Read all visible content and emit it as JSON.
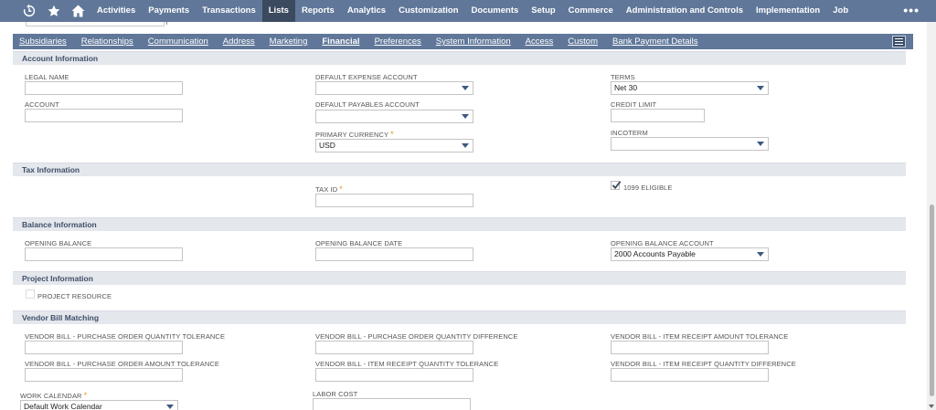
{
  "topnav": {
    "items": [
      "Activities",
      "Payments",
      "Transactions",
      "Lists",
      "Reports",
      "Analytics",
      "Customization",
      "Documents",
      "Setup",
      "Commerce",
      "Administration and Controls",
      "Implementation",
      "Job"
    ],
    "more": "•••"
  },
  "subtabs": [
    "Subsidiaries",
    "Relationships",
    "Communication",
    "Address",
    "Marketing",
    "Financial",
    "Preferences",
    "System Information",
    "Access",
    "Custom",
    "Bank Payment Details"
  ],
  "sections": {
    "account": "Account Information",
    "tax": "Tax Information",
    "balance": "Balance Information",
    "project": "Project Information",
    "vbm": "Vendor Bill Matching"
  },
  "fields": {
    "legal_name": {
      "label": "LEGAL NAME",
      "value": ""
    },
    "account": {
      "label": "ACCOUNT",
      "value": ""
    },
    "default_expense_account": {
      "label": "DEFAULT EXPENSE ACCOUNT",
      "value": ""
    },
    "default_payables_account": {
      "label": "DEFAULT PAYABLES ACCOUNT",
      "value": ""
    },
    "primary_currency": {
      "label": "PRIMARY CURRENCY",
      "value": "USD"
    },
    "terms": {
      "label": "TERMS",
      "value": "Net 30"
    },
    "credit_limit": {
      "label": "CREDIT LIMIT",
      "value": ""
    },
    "incoterm": {
      "label": "INCOTERM",
      "value": ""
    },
    "tax_id": {
      "label": "TAX ID",
      "value": ""
    },
    "eligible_1099": {
      "label": "1099 ELIGIBLE",
      "checked": true
    },
    "opening_balance": {
      "label": "OPENING BALANCE",
      "value": ""
    },
    "opening_balance_date": {
      "label": "OPENING BALANCE DATE",
      "value": ""
    },
    "opening_balance_account": {
      "label": "OPENING BALANCE ACCOUNT",
      "value": "2000 Accounts Payable"
    },
    "project_resource": {
      "label": "PROJECT RESOURCE",
      "checked": false
    },
    "vb_po_qty_tol": {
      "label": "VENDOR BILL - PURCHASE ORDER QUANTITY TOLERANCE",
      "value": ""
    },
    "vb_po_qty_diff": {
      "label": "VENDOR BILL - PURCHASE ORDER QUANTITY DIFFERENCE",
      "value": ""
    },
    "vb_ir_amt_tol": {
      "label": "VENDOR BILL - ITEM RECEIPT AMOUNT TOLERANCE",
      "value": ""
    },
    "vb_po_amt_tol": {
      "label": "VENDOR BILL - PURCHASE ORDER AMOUNT TOLERANCE",
      "value": ""
    },
    "vb_ir_qty_tol": {
      "label": "VENDOR BILL - ITEM RECEIPT QUANTITY TOLERANCE",
      "value": ""
    },
    "vb_ir_qty_diff": {
      "label": "VENDOR BILL - ITEM RECEIPT QUANTITY DIFFERENCE",
      "value": ""
    },
    "work_calendar": {
      "label": "WORK CALENDAR",
      "value": "Default Work Calendar"
    },
    "labor_cost": {
      "label": "LABOR COST",
      "value": ""
    }
  },
  "required_mark": "*",
  "icons": [
    "recent-records-icon",
    "star-icon",
    "home-icon",
    "menu-collapse-icon",
    "chevron-down-icon",
    "checkmark-icon"
  ],
  "colors": {
    "nav": "#607799",
    "nav_active": "#3b4a5e",
    "section_bg": "#e4e7ec",
    "required": "#e09a1e"
  }
}
